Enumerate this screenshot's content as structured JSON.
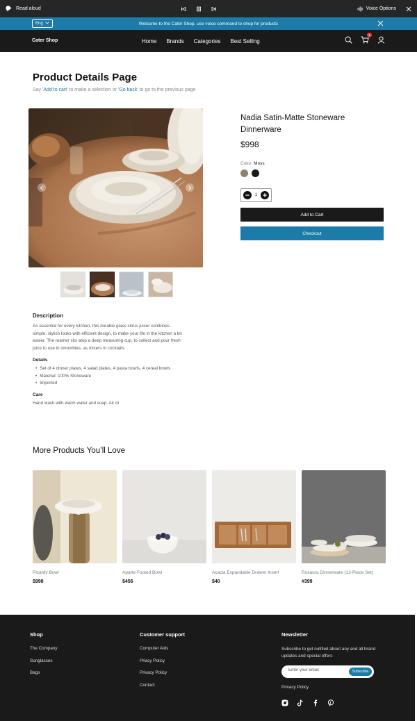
{
  "read_aloud": {
    "label": "Read aloud",
    "voice_options": "Voice Options"
  },
  "announcement": {
    "lang": "Eng",
    "text": "Welcome to the Cater Shop, use voice command to shop for products"
  },
  "nav": {
    "brand": "Cater Shop",
    "items": [
      "Home",
      "Brands",
      "Categories",
      "Best Selling"
    ],
    "cart_count": "1"
  },
  "page": {
    "title": "Product Details Page",
    "hint_prefix": "Say '",
    "hint_link1": "Add to cart",
    "hint_mid": "' to make a selection or '",
    "hint_link2": "Go back",
    "hint_suffix": "' to go to the previous page"
  },
  "product": {
    "name": "Nadia Satin-Matte Stoneware Dinnerware",
    "price": "$998",
    "color_label": "Color:",
    "color_value": "Moss",
    "swatches": [
      "#8f8370",
      "#1a1a1a"
    ],
    "quantity": "1",
    "add_to_cart": "Add to Cart",
    "checkout": "Checkout"
  },
  "description": {
    "heading": "Description",
    "text": "An essential for every kitchen, this durable glass citrus juicer combines simple, stylish looks with efficient design, to make your life in the kitchen a bit easier. The reamer sits atop a deep measuring cup, to collect and pour fresh juice to use in smoothies, as mixers in cocktails.",
    "details_heading": "Details",
    "details": [
      "Set of 4 dinner plates, 4 salad plates, 4 pasta bowls, 4 cereal bowls",
      "Material: 100% Stoneware",
      "Imported"
    ],
    "care_heading": "Care",
    "care": "Hand wash with warm water and soap. Air dr"
  },
  "more": {
    "title": "More Products You’ll Love",
    "products": [
      {
        "name": "Picardy Bowl",
        "price": "$998"
      },
      {
        "name": "Aparte Footed Bowl",
        "price": "$456"
      },
      {
        "name": "Acacia Expandable Drawer Insert",
        "price": "$40"
      },
      {
        "name": "Rosaura Dinnerware (12-Piece Set)",
        "price": "#399"
      }
    ]
  },
  "footer": {
    "shop_heading": "Shop",
    "shop_links": [
      "The Company",
      "Sunglasses",
      "Bags"
    ],
    "support_heading": "Customer support",
    "support_links": [
      "Computer Aids",
      "Priacy Policy",
      "Privacy Policy",
      "Contact"
    ],
    "newsletter_heading": "Newsletter",
    "newsletter_text": "Subscribe to get notified about any and all brand updates and special offers",
    "email_placeholder": "Enter your email",
    "subscribe": "Subscribe",
    "privacy": "Privacy Policy",
    "social_icons": [
      "instagram-icon",
      "tiktok-icon",
      "facebook-icon",
      "pinterest-icon"
    ]
  },
  "colors": {
    "accent": "#1c7ba8",
    "dark": "#1a1a1a",
    "badge": "#e53935"
  }
}
